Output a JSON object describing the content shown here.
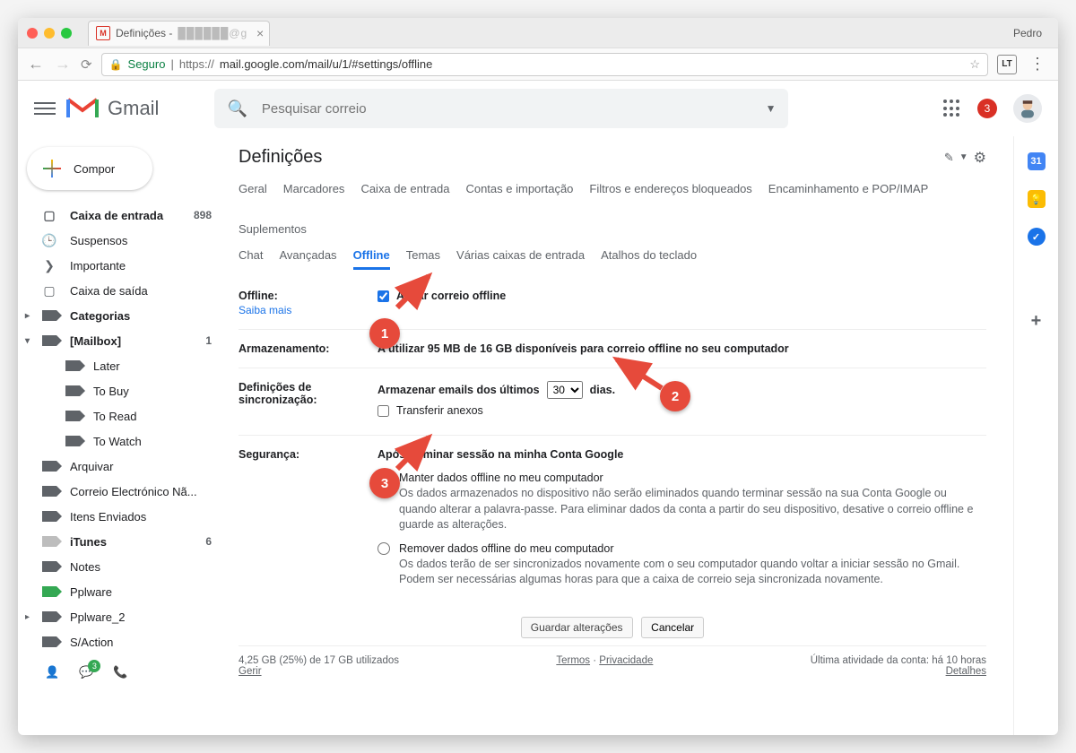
{
  "browser": {
    "profile_name": "Pedro",
    "tab_title": "Definições -",
    "tab_mask": "██████@g",
    "secure_label": "Seguro",
    "url_prefix": "https://",
    "url_path": "mail.google.com/mail/u/1/#settings/offline",
    "ext_label": "LT"
  },
  "header": {
    "brand": "Gmail",
    "search_placeholder": "Pesquisar correio",
    "notif_count": "3"
  },
  "compose_label": "Compor",
  "sidebar": [
    {
      "icon": "inbox",
      "label": "Caixa de entrada",
      "count": "898",
      "bold": true
    },
    {
      "icon": "clock",
      "label": "Suspensos"
    },
    {
      "icon": "chev",
      "label": "Importante"
    },
    {
      "icon": "square",
      "label": "Caixa de saída"
    },
    {
      "icon": "tag",
      "label": "Categorias",
      "bold": true,
      "expand": "▸"
    },
    {
      "icon": "tag",
      "label": "[Mailbox]",
      "bold": true,
      "expand": "▾",
      "count": "1"
    },
    {
      "icon": "tag",
      "label": "Later",
      "indent": true
    },
    {
      "icon": "tag",
      "label": "To Buy",
      "indent": true
    },
    {
      "icon": "tag",
      "label": "To Read",
      "indent": true
    },
    {
      "icon": "tag",
      "label": "To Watch",
      "indent": true
    },
    {
      "icon": "tag",
      "label": "Arquivar"
    },
    {
      "icon": "tag",
      "label": "Correio Electrónico Nã..."
    },
    {
      "icon": "tag",
      "label": "Itens Enviados"
    },
    {
      "icon": "tag-light",
      "label": "iTunes",
      "bold": true,
      "count": "6"
    },
    {
      "icon": "tag",
      "label": "Notes"
    },
    {
      "icon": "tag-green",
      "label": "Pplware"
    },
    {
      "icon": "tag",
      "label": "Pplware_2",
      "expand": "▸"
    },
    {
      "icon": "tag",
      "label": "S/Action"
    }
  ],
  "settings": {
    "title": "Definições",
    "tabs_row1": [
      "Geral",
      "Marcadores",
      "Caixa de entrada",
      "Contas e importação",
      "Filtros e endereços bloqueados",
      "Encaminhamento e POP/IMAP",
      "Suplementos"
    ],
    "tabs_row2": [
      "Chat",
      "Avançadas",
      "Offline",
      "Temas",
      "Várias caixas de entrada",
      "Atalhos do teclado"
    ],
    "active_tab": "Offline",
    "offline": {
      "label": "Offline:",
      "learn_more": "Saiba mais",
      "checkbox_label": "Ativar correio offline"
    },
    "storage": {
      "label": "Armazenamento:",
      "text": "A utilizar 95 MB de 16 GB disponíveis para correio offline no seu computador"
    },
    "sync": {
      "label": "Definições de sincronização:",
      "text_before": "Armazenar emails dos últimos",
      "select_value": "30",
      "text_after": "dias.",
      "attachments_label": "Transferir anexos"
    },
    "security": {
      "label": "Segurança:",
      "heading": "Após terminar sessão na minha Conta Google",
      "opt1_title": "Manter dados offline no meu computador",
      "opt1_desc": "Os dados armazenados no dispositivo não serão eliminados quando terminar sessão na sua Conta Google ou quando alterar a palavra-passe. Para eliminar dados da conta a partir do seu dispositivo, desative o correio offline e guarde as alterações.",
      "opt2_title": "Remover dados offline do meu computador",
      "opt2_desc": "Os dados terão de ser sincronizados novamente com o seu computador quando voltar a iniciar sessão no Gmail. Podem ser necessárias algumas horas para que a caixa de correio seja sincronizada novamente."
    },
    "save_btn": "Guardar alterações",
    "cancel_btn": "Cancelar",
    "footer": {
      "storage_line": "4,25 GB (25%) de 17 GB utilizados",
      "manage": "Gerir",
      "terms": "Termos",
      "sep": " · ",
      "privacy": "Privacidade",
      "activity_line": "Última atividade da conta: há 10 horas",
      "details": "Detalhes"
    }
  },
  "sidepanel": {
    "cal": "31"
  },
  "annotations": {
    "a1": "1",
    "a2": "2",
    "a3": "3"
  }
}
